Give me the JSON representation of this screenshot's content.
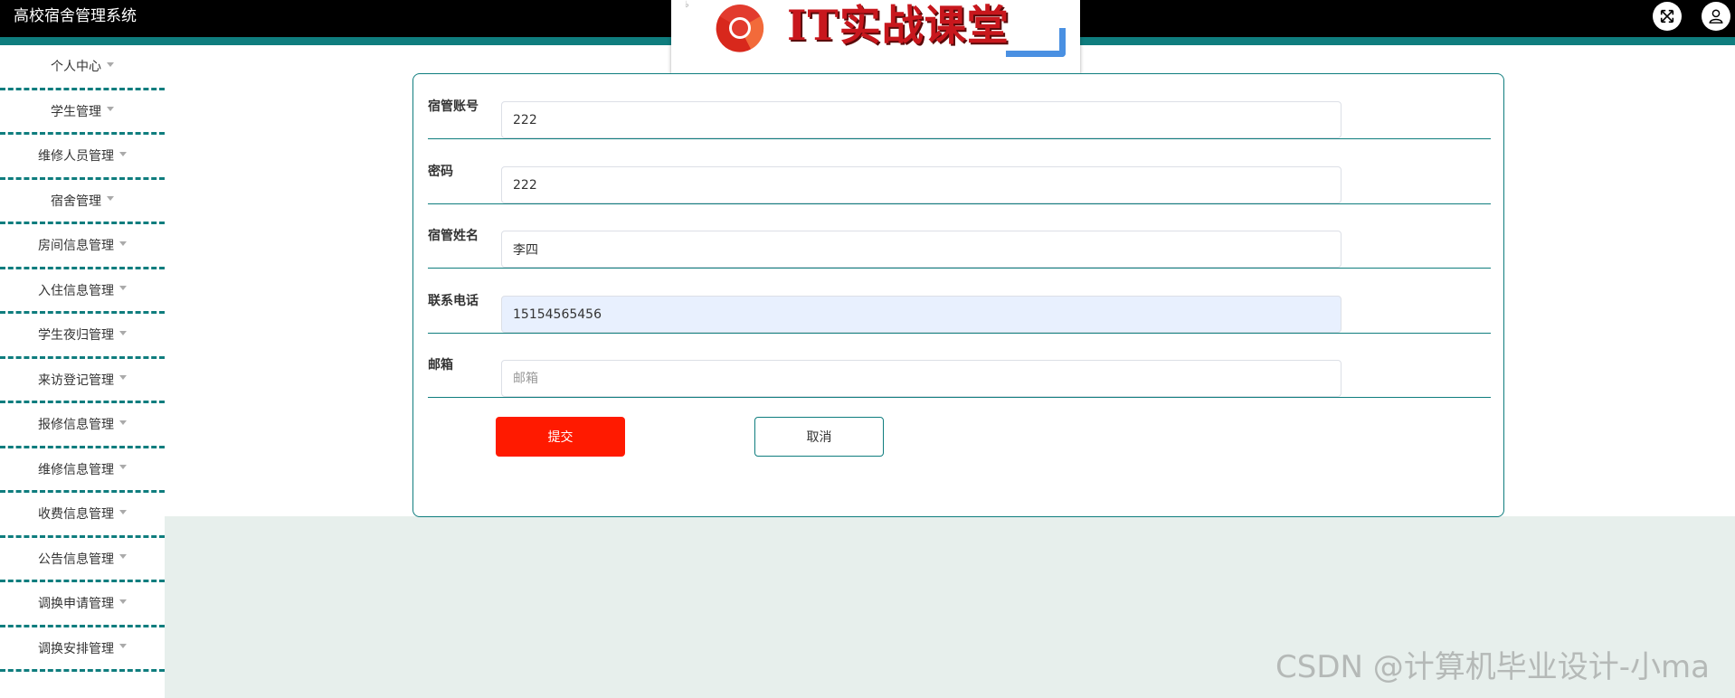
{
  "header": {
    "app_title": "高校宿舍管理系统",
    "fullscreen_icon": "expand-arrows-icon",
    "user_icon": "user-icon",
    "accent_color": "#0f7d7e"
  },
  "overlay": {
    "logo_text": "IT实战课堂",
    "logo_icon": "chrome-logo-icon"
  },
  "sidebar": {
    "items": [
      {
        "label": "个人中心"
      },
      {
        "label": "学生管理"
      },
      {
        "label": "维修人员管理"
      },
      {
        "label": "宿舍管理"
      },
      {
        "label": "房间信息管理"
      },
      {
        "label": "入住信息管理"
      },
      {
        "label": "学生夜归管理"
      },
      {
        "label": "来访登记管理"
      },
      {
        "label": "报修信息管理"
      },
      {
        "label": "维修信息管理"
      },
      {
        "label": "收费信息管理"
      },
      {
        "label": "公告信息管理"
      },
      {
        "label": "调换申请管理"
      },
      {
        "label": "调换安排管理"
      }
    ]
  },
  "form": {
    "fields": [
      {
        "label": "宿管账号",
        "value": "222",
        "placeholder": ""
      },
      {
        "label": "密码",
        "value": "222",
        "placeholder": ""
      },
      {
        "label": "宿管姓名",
        "value": "李四",
        "placeholder": ""
      },
      {
        "label": "联系电话",
        "value": "15154565456",
        "placeholder": ""
      },
      {
        "label": "邮箱",
        "value": "",
        "placeholder": "邮箱"
      }
    ],
    "submit_label": "提交",
    "cancel_label": "取消",
    "submit_color": "#ff1a00"
  },
  "watermark": {
    "text": "CSDN @计算机毕业设计-小ma"
  }
}
